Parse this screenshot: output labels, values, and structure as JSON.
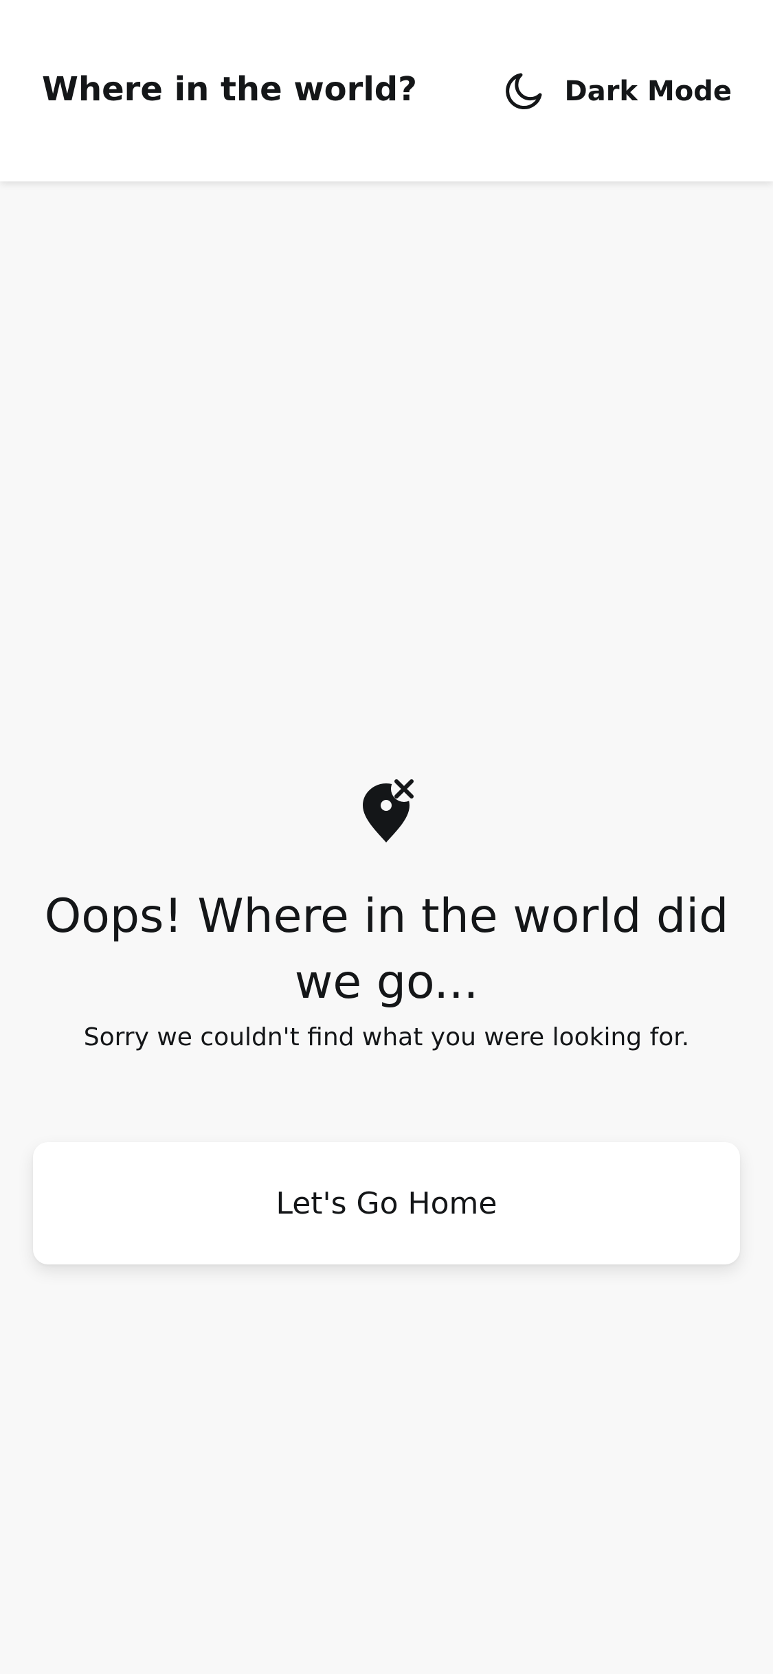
{
  "header": {
    "title": "Where in the world?",
    "theme_toggle": {
      "icon": "moon-icon",
      "label": "Dark Mode"
    }
  },
  "error": {
    "icon": "map-pin-off-icon",
    "title": "Oops! Where in the world did we go...",
    "subtitle": "Sorry we couldn't find what you were looking for.",
    "button_label": "Let's Go Home"
  },
  "colors": {
    "background": "#f8f8f8",
    "surface": "#ffffff",
    "text": "#141618"
  }
}
